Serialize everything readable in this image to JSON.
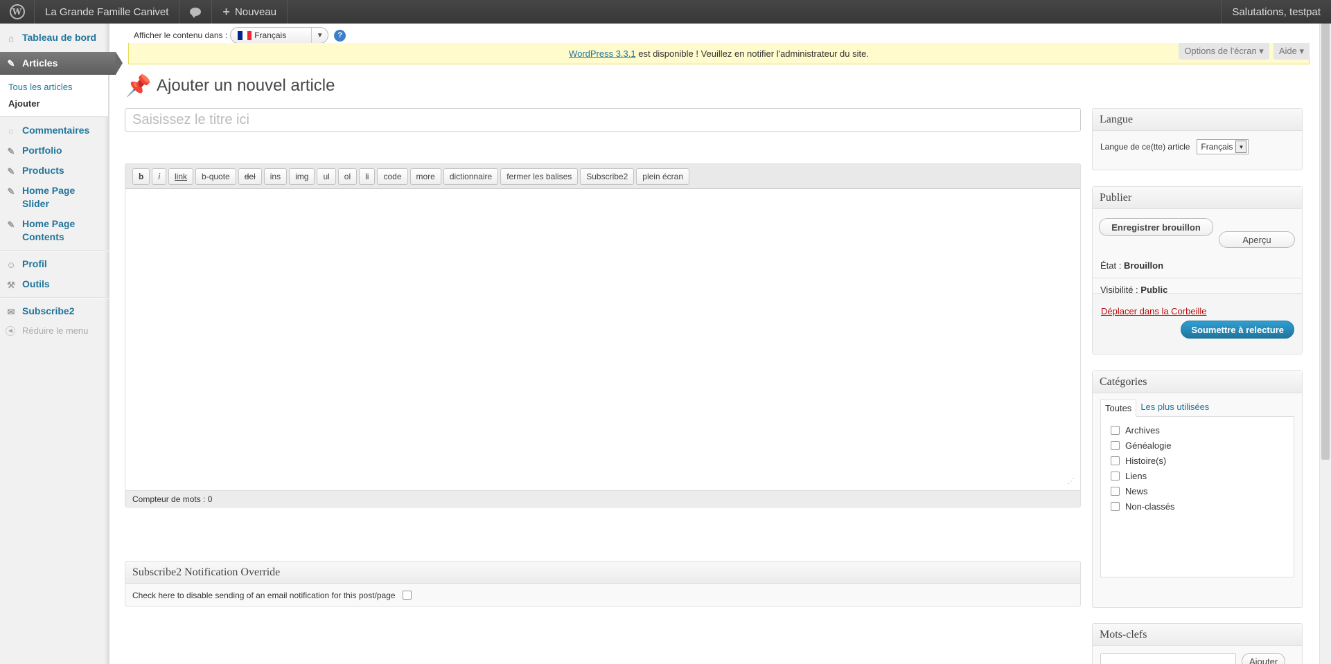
{
  "adminbar": {
    "site_name": "La Grande Famille Canivet",
    "new_label": "Nouveau",
    "greeting": "Salutations, testpat"
  },
  "sidebar": {
    "items": [
      {
        "label": "Tableau de bord",
        "icon": "home-icon"
      },
      {
        "label": "Articles",
        "icon": "pin-icon"
      },
      {
        "label": "Commentaires",
        "icon": "comment-icon"
      },
      {
        "label": "Portfolio",
        "icon": "pin-icon"
      },
      {
        "label": "Products",
        "icon": "pin-icon"
      },
      {
        "label": "Home Page Slider",
        "icon": "pin-icon"
      },
      {
        "label": "Home Page Contents",
        "icon": "pin-icon"
      },
      {
        "label": "Profil",
        "icon": "users-icon"
      },
      {
        "label": "Outils",
        "icon": "tools-icon"
      },
      {
        "label": "Subscribe2",
        "icon": "mail-icon"
      }
    ],
    "submenu": [
      "Tous les articles",
      "Ajouter"
    ],
    "collapse_label": "Réduire le menu"
  },
  "lang_bar": {
    "label": "Afficher le contenu dans :",
    "selected": "Français"
  },
  "screen_options": {
    "options_label": "Options de l'écran",
    "help_label": "Aide"
  },
  "notice": {
    "link": "WordPress 3.3.1",
    "text": " est disponible ! Veuillez en notifier l'administrateur du site."
  },
  "page": {
    "title": "Ajouter un nouvel article",
    "title_placeholder": "Saisissez le titre ici"
  },
  "quicktags": [
    "b",
    "i",
    "link",
    "b-quote",
    "del",
    "ins",
    "img",
    "ul",
    "ol",
    "li",
    "code",
    "more",
    "dictionnaire",
    "fermer les balises",
    "Subscribe2",
    "plein écran"
  ],
  "editor": {
    "wordcount_label": "Compteur de mots : ",
    "wordcount": "0"
  },
  "subscribe2_box": {
    "title": "Subscribe2 Notification Override",
    "checkbox_label": "Check here to disable sending of an email notification for this post/page"
  },
  "language_box": {
    "title": "Langue",
    "label": "Langue de ce(tte) article",
    "selected": "Français"
  },
  "publish_box": {
    "title": "Publier",
    "save_draft": "Enregistrer brouillon",
    "preview": "Aperçu",
    "status_label": "État : ",
    "status_value": "Brouillon",
    "visibility_label": "Visibilité : ",
    "visibility_value": "Public",
    "trash": "Déplacer dans la Corbeille",
    "submit": "Soumettre à relecture"
  },
  "categories_box": {
    "title": "Catégories",
    "tab_all": "Toutes",
    "tab_popular": "Les plus utilisées",
    "items": [
      "Archives",
      "Généalogie",
      "Histoire(s)",
      "Liens",
      "News",
      "Non-classés"
    ]
  },
  "tags_box": {
    "title": "Mots-clefs",
    "add_button": "Ajouter"
  },
  "colors": {
    "link": "#21759b",
    "adminbar": "#464646",
    "notice_bg": "#fffbcc",
    "primary_button": "#21759b",
    "trash": "#bc0b0b"
  }
}
